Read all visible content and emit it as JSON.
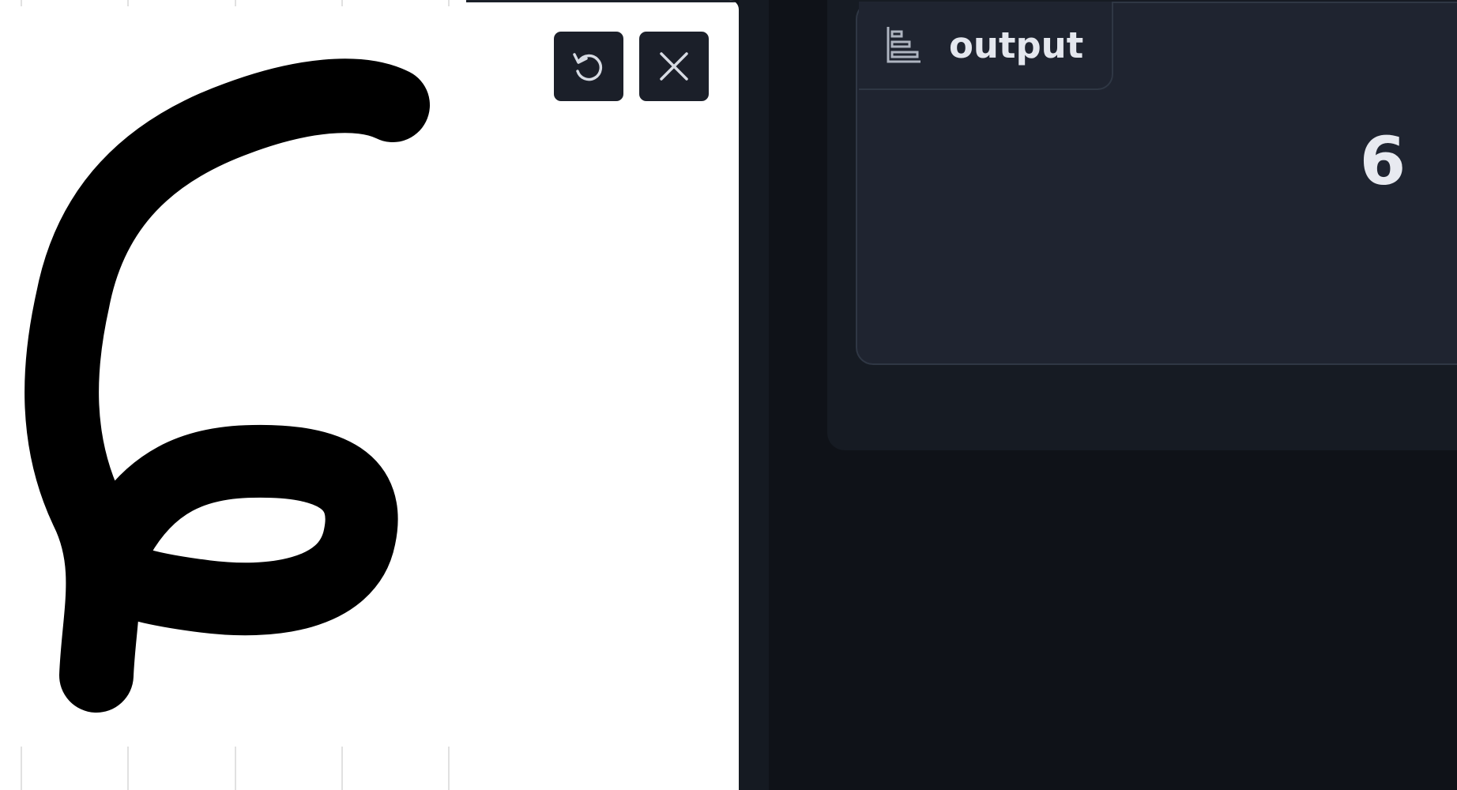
{
  "sketchpad": {
    "undo_icon": "undo-icon",
    "clear_icon": "close-icon",
    "stroke_color": "#000000",
    "background_color": "#ffffff"
  },
  "output": {
    "label": "output",
    "label_icon": "chart-icon",
    "value": "6"
  },
  "colors": {
    "page_bg": "#0f1218",
    "panel_bg": "#1f2430",
    "border": "#2f3744",
    "button_bg": "#1b1f29",
    "text": "#e4e7ee"
  }
}
